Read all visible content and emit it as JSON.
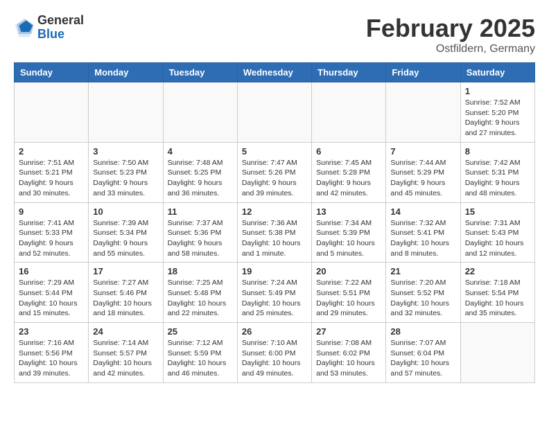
{
  "header": {
    "logo_general": "General",
    "logo_blue": "Blue",
    "month_title": "February 2025",
    "location": "Ostfildern, Germany"
  },
  "weekdays": [
    "Sunday",
    "Monday",
    "Tuesday",
    "Wednesday",
    "Thursday",
    "Friday",
    "Saturday"
  ],
  "weeks": [
    [
      {
        "day": "",
        "info": ""
      },
      {
        "day": "",
        "info": ""
      },
      {
        "day": "",
        "info": ""
      },
      {
        "day": "",
        "info": ""
      },
      {
        "day": "",
        "info": ""
      },
      {
        "day": "",
        "info": ""
      },
      {
        "day": "1",
        "info": "Sunrise: 7:52 AM\nSunset: 5:20 PM\nDaylight: 9 hours and 27 minutes."
      }
    ],
    [
      {
        "day": "2",
        "info": "Sunrise: 7:51 AM\nSunset: 5:21 PM\nDaylight: 9 hours and 30 minutes."
      },
      {
        "day": "3",
        "info": "Sunrise: 7:50 AM\nSunset: 5:23 PM\nDaylight: 9 hours and 33 minutes."
      },
      {
        "day": "4",
        "info": "Sunrise: 7:48 AM\nSunset: 5:25 PM\nDaylight: 9 hours and 36 minutes."
      },
      {
        "day": "5",
        "info": "Sunrise: 7:47 AM\nSunset: 5:26 PM\nDaylight: 9 hours and 39 minutes."
      },
      {
        "day": "6",
        "info": "Sunrise: 7:45 AM\nSunset: 5:28 PM\nDaylight: 9 hours and 42 minutes."
      },
      {
        "day": "7",
        "info": "Sunrise: 7:44 AM\nSunset: 5:29 PM\nDaylight: 9 hours and 45 minutes."
      },
      {
        "day": "8",
        "info": "Sunrise: 7:42 AM\nSunset: 5:31 PM\nDaylight: 9 hours and 48 minutes."
      }
    ],
    [
      {
        "day": "9",
        "info": "Sunrise: 7:41 AM\nSunset: 5:33 PM\nDaylight: 9 hours and 52 minutes."
      },
      {
        "day": "10",
        "info": "Sunrise: 7:39 AM\nSunset: 5:34 PM\nDaylight: 9 hours and 55 minutes."
      },
      {
        "day": "11",
        "info": "Sunrise: 7:37 AM\nSunset: 5:36 PM\nDaylight: 9 hours and 58 minutes."
      },
      {
        "day": "12",
        "info": "Sunrise: 7:36 AM\nSunset: 5:38 PM\nDaylight: 10 hours and 1 minute."
      },
      {
        "day": "13",
        "info": "Sunrise: 7:34 AM\nSunset: 5:39 PM\nDaylight: 10 hours and 5 minutes."
      },
      {
        "day": "14",
        "info": "Sunrise: 7:32 AM\nSunset: 5:41 PM\nDaylight: 10 hours and 8 minutes."
      },
      {
        "day": "15",
        "info": "Sunrise: 7:31 AM\nSunset: 5:43 PM\nDaylight: 10 hours and 12 minutes."
      }
    ],
    [
      {
        "day": "16",
        "info": "Sunrise: 7:29 AM\nSunset: 5:44 PM\nDaylight: 10 hours and 15 minutes."
      },
      {
        "day": "17",
        "info": "Sunrise: 7:27 AM\nSunset: 5:46 PM\nDaylight: 10 hours and 18 minutes."
      },
      {
        "day": "18",
        "info": "Sunrise: 7:25 AM\nSunset: 5:48 PM\nDaylight: 10 hours and 22 minutes."
      },
      {
        "day": "19",
        "info": "Sunrise: 7:24 AM\nSunset: 5:49 PM\nDaylight: 10 hours and 25 minutes."
      },
      {
        "day": "20",
        "info": "Sunrise: 7:22 AM\nSunset: 5:51 PM\nDaylight: 10 hours and 29 minutes."
      },
      {
        "day": "21",
        "info": "Sunrise: 7:20 AM\nSunset: 5:52 PM\nDaylight: 10 hours and 32 minutes."
      },
      {
        "day": "22",
        "info": "Sunrise: 7:18 AM\nSunset: 5:54 PM\nDaylight: 10 hours and 35 minutes."
      }
    ],
    [
      {
        "day": "23",
        "info": "Sunrise: 7:16 AM\nSunset: 5:56 PM\nDaylight: 10 hours and 39 minutes."
      },
      {
        "day": "24",
        "info": "Sunrise: 7:14 AM\nSunset: 5:57 PM\nDaylight: 10 hours and 42 minutes."
      },
      {
        "day": "25",
        "info": "Sunrise: 7:12 AM\nSunset: 5:59 PM\nDaylight: 10 hours and 46 minutes."
      },
      {
        "day": "26",
        "info": "Sunrise: 7:10 AM\nSunset: 6:00 PM\nDaylight: 10 hours and 49 minutes."
      },
      {
        "day": "27",
        "info": "Sunrise: 7:08 AM\nSunset: 6:02 PM\nDaylight: 10 hours and 53 minutes."
      },
      {
        "day": "28",
        "info": "Sunrise: 7:07 AM\nSunset: 6:04 PM\nDaylight: 10 hours and 57 minutes."
      },
      {
        "day": "",
        "info": ""
      }
    ]
  ]
}
